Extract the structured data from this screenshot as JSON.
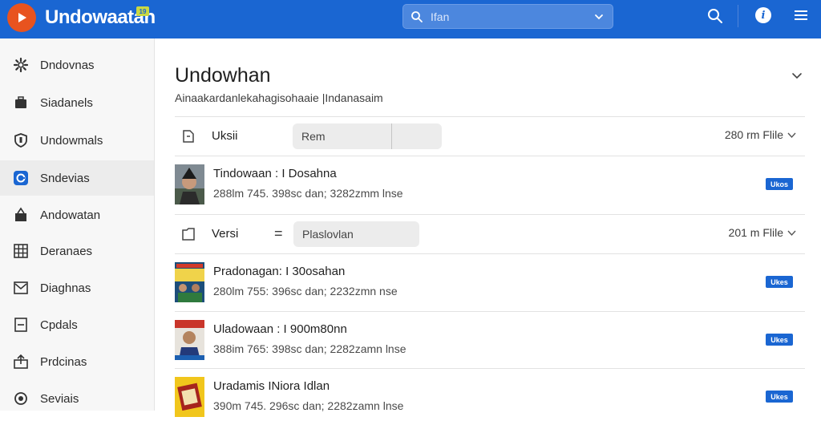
{
  "app": {
    "title": "Undowaatan",
    "badge": "19"
  },
  "search": {
    "value": "Ifan"
  },
  "sidebar": {
    "items": [
      {
        "label": "Dndovnas",
        "icon": "gear-icon"
      },
      {
        "label": "Siadanels",
        "icon": "briefcase-icon"
      },
      {
        "label": "Undowmals",
        "icon": "shield-icon"
      },
      {
        "label": "Sndevias",
        "icon": "badge-icon"
      },
      {
        "label": "Andowatan",
        "icon": "bag-icon"
      },
      {
        "label": "Deranaes",
        "icon": "grid-icon"
      },
      {
        "label": "Diaghnas",
        "icon": "image-icon"
      },
      {
        "label": "Cpdals",
        "icon": "document-icon"
      },
      {
        "label": "Prdcinas",
        "icon": "share-icon"
      },
      {
        "label": "Seviais",
        "icon": "settings-icon"
      }
    ]
  },
  "main": {
    "title": "Undowhan",
    "subtitle": "Ainaakardanlekahagisohaaie |Indanasaim",
    "groups": [
      {
        "label": "Uksii",
        "field": "Rem",
        "count": "280 rm Flile"
      },
      {
        "label": "Versi",
        "eq": "=",
        "field": "Plaslovlan",
        "count": "201 m Flile"
      }
    ],
    "items": [
      {
        "title": "Tindowaan : I Dosahna",
        "meta": "288lm 745.  398sc dan;  3282zmm lnse",
        "badge": "Ukos"
      },
      {
        "title": "Pradonagan: I 30osahan",
        "meta": "280lm 755:  396sc dan;  2232zmn nse",
        "badge": "Ukes"
      },
      {
        "title": "Uladowaan : I 900m80nn",
        "meta": "388im 765:  398sc dan;  2282zamn lnse",
        "badge": "Ukes"
      },
      {
        "title": "Uradamis INiora Idlan",
        "meta": "390m 745.  296sc dan;  2282zamn lnse",
        "badge": "Ukes"
      }
    ]
  },
  "colors": {
    "brand": "#1a66d2",
    "logo": "#e8531f",
    "badge": "#1a66d2"
  }
}
